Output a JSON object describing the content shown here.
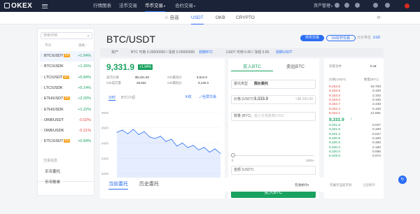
{
  "brand": {
    "name": "OKEX"
  },
  "topnav": {
    "items": [
      "行情图表",
      "法币交易",
      "币币交易",
      "合约交易"
    ],
    "active": 2,
    "assets": "资产管理",
    "dropdown_caret": "▾"
  },
  "subnav": {
    "tabs": [
      "自选",
      "USDT",
      "OKB",
      "CRYPTO"
    ],
    "active_index": 1,
    "star_glyph": "☆"
  },
  "sidebar": {
    "search_placeholder": "搜索币种",
    "col_pair": "币对",
    "col_change": "涨幅 ↓",
    "pairs": [
      {
        "name": "BTC/USDT",
        "tag": "10X",
        "change": "+1.94%",
        "dir": "up",
        "selected": true
      },
      {
        "name": "BTC/USDK",
        "tag": "",
        "change": "+1.26%",
        "dir": "up",
        "selected": false
      },
      {
        "name": "LTC/USDT",
        "tag": "10X",
        "change": "+5.84%",
        "dir": "up",
        "selected": false
      },
      {
        "name": "LTC/USDK",
        "tag": "",
        "change": "+5.14%",
        "dir": "up",
        "selected": false
      },
      {
        "name": "ETH/USDT",
        "tag": "10X",
        "change": "+2.20%",
        "dir": "up",
        "selected": false
      },
      {
        "name": "ETH/USDK",
        "tag": "",
        "change": "+1.22%",
        "dir": "up",
        "selected": false
      },
      {
        "name": "OKB/USDT",
        "tag": "",
        "change": "-0.02%",
        "dir": "down",
        "selected": false
      },
      {
        "name": "OKB/USDK",
        "tag": "",
        "change": "-0.21%",
        "dir": "down",
        "selected": false
      },
      {
        "name": "ETC/USDT",
        "tag": "10X",
        "change": "+0.84%",
        "dir": "up",
        "selected": false
      }
    ],
    "section_title": "交易信息",
    "links": [
      "币币委托",
      "币币账单"
    ]
  },
  "main": {
    "pair_title": "BTC/USDT",
    "btn_spot": "币币交易",
    "btn_margin": "5X杠杆交易",
    "unit_label": "计价单位",
    "unit_value": "USD",
    "assets": {
      "label": "资产",
      "btc": "BTC 可用 0.00000000 / 冻结 0.00000000",
      "btc_link": "划转BTC",
      "usdt": "USDT 可用 0.00 / 冻结 0.00",
      "usdt_link": "划转USDT"
    }
  },
  "ticker": {
    "price": "9,331.9",
    "change_pct": "+1.94%",
    "stats": [
      {
        "label": "美元价格",
        "value": "$9,331.90"
      },
      {
        "label": "24h最高价",
        "value": "9,524.0"
      },
      {
        "label": "24h成交量",
        "value": "28,532"
      },
      {
        "label": "24h最低价",
        "value": "9,145.0"
      }
    ],
    "chart_tabs": [
      "分时",
      "BTC介绍"
    ],
    "kline_link": "K线",
    "full_link": "全屏交易",
    "full_icon": "⤢"
  },
  "chart_data": {
    "type": "line",
    "x": [
      "08:00",
      "09:00",
      "10:00",
      "11:00",
      "12:00",
      "13:00",
      "14:00",
      "15:00",
      "16:00"
    ],
    "y": [
      9470,
      9485,
      9460,
      9490,
      9455,
      9475,
      9440,
      9430,
      9445,
      9410,
      9425,
      9380,
      9400,
      9370,
      9385,
      9355,
      9372,
      9340,
      9362,
      9331
    ],
    "yticks": [
      9600,
      9500,
      9400,
      9300,
      9200
    ],
    "xticks": [
      "10:00",
      "11:00",
      "12:00",
      "13:00",
      "14:00",
      "16:00"
    ],
    "ylim": [
      9150,
      9650
    ],
    "grid": true,
    "line_color": "#2b6ef5"
  },
  "trade": {
    "tab_buy": "买入BTC",
    "tab_sell": "卖出BTC",
    "order_type_label": "委托类型",
    "order_type_value": "限价委托",
    "price_label": "价格 (USDT)",
    "price_value": "9,333.9",
    "price_hint": "≈$9,333.90",
    "qty_label": "数量 (BTC)",
    "qty_placeholder": "最小交易数量0.001",
    "pct_start": "0",
    "pct_end": "100%",
    "amount_label": "金额 (USDT)",
    "avail_label": "可买 BTC: 0.00000000",
    "avail_usdt": "USDT 余额: 0.00",
    "buy_button": "买入BTC"
  },
  "orderbook": {
    "depth_label": "深度合并",
    "depth_value": "0.1",
    "col_price": "价格(USDT)",
    "col_qty": "数量(BTC)",
    "asks": [
      {
        "p": "9,333.9",
        "q": "19.700"
      },
      {
        "p": "9,333.6",
        "q": "0.100"
      },
      {
        "p": "9,333.3",
        "q": "2.162"
      },
      {
        "p": "9,333.0",
        "q": "0.100"
      },
      {
        "p": "9,332.7",
        "q": "2.430"
      },
      {
        "p": "9,332.4",
        "q": "0.100"
      },
      {
        "p": "9,332.1",
        "q": "12.691"
      }
    ],
    "last": "9,331.9",
    "last_arrow": "↑",
    "bids": [
      {
        "p": "9,331.8",
        "q": "0.027"
      },
      {
        "p": "9,331.6",
        "q": "0.100"
      },
      {
        "p": "9,331.2",
        "q": "0.027"
      },
      {
        "p": "9,330.8",
        "q": "0.100"
      },
      {
        "p": "9,330.6",
        "q": "0.480"
      },
      {
        "p": "9,330.3",
        "q": "2.150"
      },
      {
        "p": "9,330.0",
        "q": "0.066"
      },
      {
        "p": "9,329.5",
        "q": "0.072"
      }
    ]
  },
  "bottom": {
    "tabs": [
      "当前委托",
      "历史委托"
    ],
    "filter": "普通委托",
    "show_all": "仅展示当前币对",
    "cancel_all": "全部撤单"
  },
  "colors": {
    "accent": "#2b6ef5",
    "up": "#1aa260",
    "down": "#e2483d",
    "nav": "#1b2338"
  },
  "icons": [
    "hamburger-icon",
    "user-icon",
    "github-icon",
    "mail-icon",
    "globe-icon",
    "chat-icon",
    "flag-cn-icon"
  ]
}
